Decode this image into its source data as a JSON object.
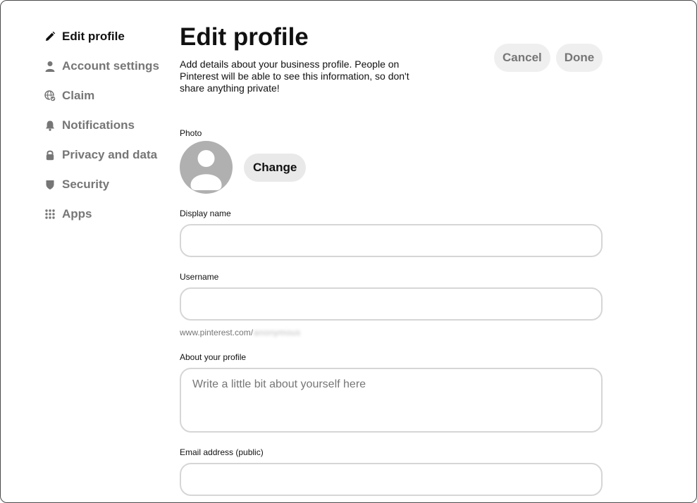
{
  "sidebar": {
    "items": [
      {
        "label": "Edit profile",
        "icon": "pencil-icon",
        "active": true
      },
      {
        "label": "Account settings",
        "icon": "person-icon"
      },
      {
        "label": "Claim",
        "icon": "globe-check-icon"
      },
      {
        "label": "Notifications",
        "icon": "bell-icon"
      },
      {
        "label": "Privacy and data",
        "icon": "lock-icon"
      },
      {
        "label": "Security",
        "icon": "shield-icon"
      },
      {
        "label": "Apps",
        "icon": "grid-icon"
      }
    ]
  },
  "header": {
    "title": "Edit profile",
    "subtitle": "Add details about your business profile. People on Pinterest will be able to see this information, so don't share anything private!",
    "cancel_label": "Cancel",
    "done_label": "Done"
  },
  "photo": {
    "label": "Photo",
    "change_label": "Change"
  },
  "display_name": {
    "label": "Display name",
    "value": ""
  },
  "username": {
    "label": "Username",
    "value": "",
    "url_prefix": "www.pinterest.com/",
    "url_suffix_blurred": "anonymous"
  },
  "about": {
    "label": "About your profile",
    "placeholder": "Write a little bit about yourself here"
  },
  "email": {
    "label": "Email address (public)",
    "value": ""
  },
  "colors": {
    "text_primary": "#111111",
    "text_secondary": "#767676",
    "button_bg": "#efefef",
    "field_border": "#d6d6d6",
    "avatar_bg": "#b0b0b0"
  }
}
